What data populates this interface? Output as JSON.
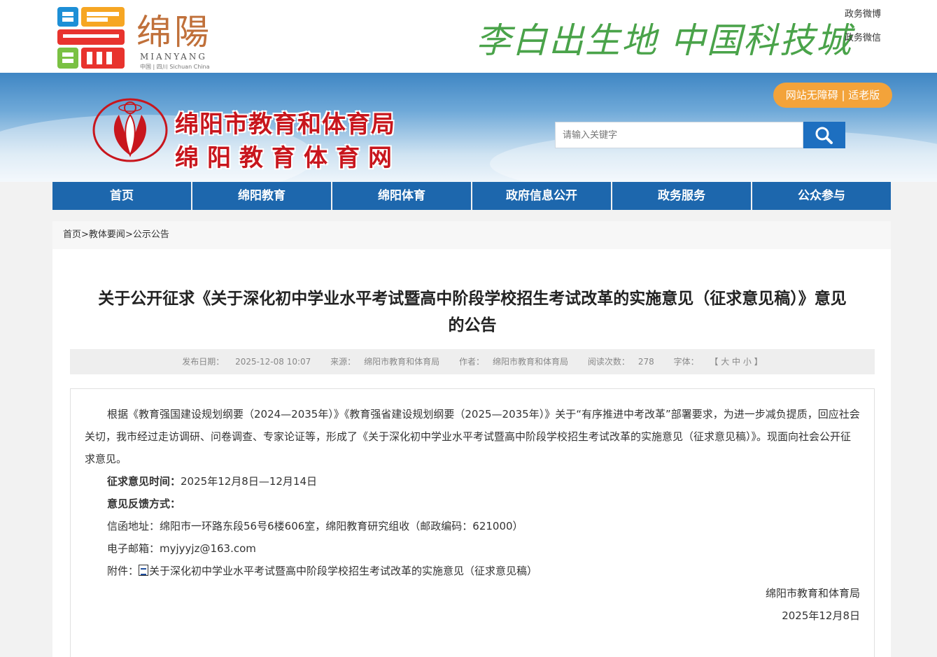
{
  "header": {
    "logo_cn": "绵陽",
    "logo_en": "MIANYANG",
    "logo_sub": "中国 | 四川 Sichuan China",
    "slogan": "李白出生地 中国科技城",
    "social_weibo": "政务微博",
    "social_weixin": "政务微信"
  },
  "banner": {
    "title_line1": "绵阳市教育和体育局",
    "title_line2": "绵阳教育体育网",
    "accessibility": "网站无障碍 | 适老版",
    "search_placeholder": "请输入关键字"
  },
  "nav": {
    "items": [
      "首页",
      "绵阳教育",
      "绵阳体育",
      "政府信息公开",
      "政务服务",
      "公众参与"
    ]
  },
  "breadcrumb": {
    "home": "首页",
    "sep": ">",
    "level1": "教体要闻",
    "level2": "公示公告"
  },
  "article": {
    "title_line1": "关于公开征求《关于深化初中学业水平考试暨高中阶段学校招生考试改革的实施意见（征求意见稿）》意见",
    "title_line2": "的公告",
    "meta": {
      "date_label": "发布日期：",
      "date": "2025-12-08 10:07",
      "source_label": "来源：",
      "source": "绵阳市教育和体育局",
      "author_label": "作者：",
      "author": "绵阳市教育和体育局",
      "views_label": "阅读次数：",
      "views": "278",
      "font_label": "字体：",
      "font_options": "【 大  中  小 】"
    },
    "paragraph1": "根据《教育强国建设规划纲要（2024—2035年）》《教育强省建设规划纲要（2025—2035年）》关于“有序推进中考改革”部署要求，为进一步减负提质，回应社会关切，我市经过走访调研、问卷调查、专家论证等，形成了《关于深化初中学业水平考试暨高中阶段学校招生考试改革的实施意见（征求意见稿）》。现面向社会公开征求意见。",
    "period_label": "征求意见时间：",
    "period": "2025年12月8日—12月14日",
    "feedback_label": "意见反馈方式：",
    "address_label": "信函地址：",
    "address": "绵阳市一环路东段56号6楼606室，绵阳教育研究组收（邮政编码：621000）",
    "email_label": "电子邮箱：",
    "email": "myjyyjz@163.com",
    "attachment_label": "附件：",
    "attachment": "关于深化初中学业水平考试暨高中阶段学校招生考试改革的实施意见（征求意见稿）",
    "signature": "绵阳市教育和体育局",
    "sign_date": "2025年12月8日"
  },
  "colors": {
    "nav_bg": "#1d67ad",
    "title_red": "#c8161d",
    "access_orange": "#f3a33a",
    "search_btn": "#1d6fc0"
  }
}
